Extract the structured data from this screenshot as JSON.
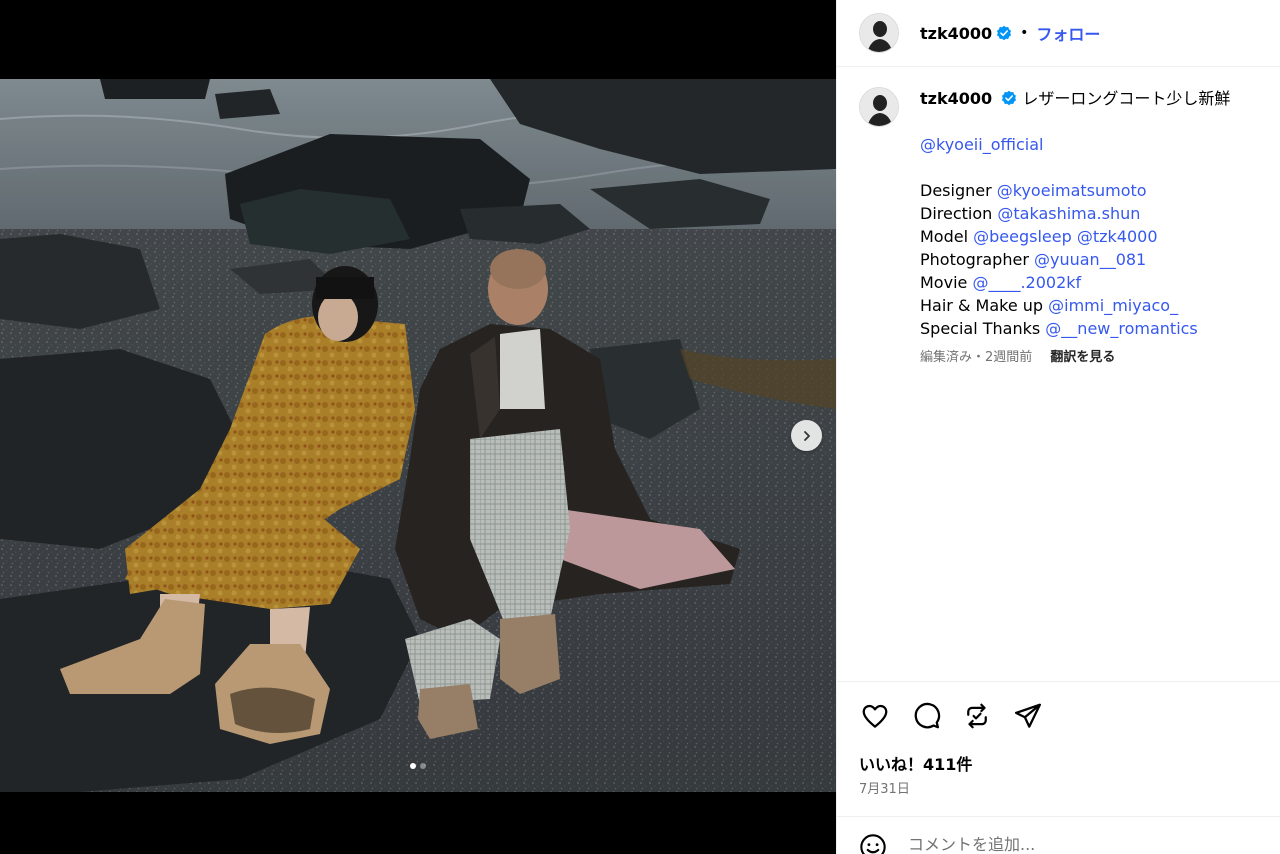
{
  "post": {
    "username": "tzk4000",
    "follow_label": "フォロー",
    "separator": "•",
    "verified_icon": "verified-badge-icon"
  },
  "caption": {
    "username": "tzk4000",
    "text": "レザーロングコート少し新鮮",
    "brand_mention": "@kyoeii_official",
    "credits": [
      {
        "role": "Designer",
        "mentions": [
          "@kyoeimatsumoto"
        ]
      },
      {
        "role": "Direction",
        "mentions": [
          "@takashima.shun"
        ]
      },
      {
        "role": "Model",
        "mentions": [
          "@beegsleep",
          "@tzk4000"
        ]
      },
      {
        "role": "Photographer",
        "mentions": [
          "@yuuan__081"
        ]
      },
      {
        "role": "Movie",
        "mentions": [
          "@____.2002kf"
        ]
      },
      {
        "role": "Hair & Make up",
        "mentions": [
          "@immi_miyaco_"
        ]
      },
      {
        "role": "Special Thanks",
        "mentions": [
          "@__new_romantics"
        ]
      }
    ],
    "meta": "編集済み・2週間前",
    "translate_label": "翻訳を見る"
  },
  "actions": {
    "icons": [
      "heart-icon",
      "comment-icon",
      "repost-icon",
      "share-icon"
    ],
    "likes": "いいね！411件",
    "date": "7月31日"
  },
  "comment": {
    "placeholder": "コメントを追加...",
    "emoji_icon": "emoji-icon"
  },
  "carousel": {
    "slide_count": 2,
    "active_index": 0
  },
  "colors": {
    "link": "#3658ee",
    "muted": "#737373",
    "verified": "#0095f6"
  }
}
